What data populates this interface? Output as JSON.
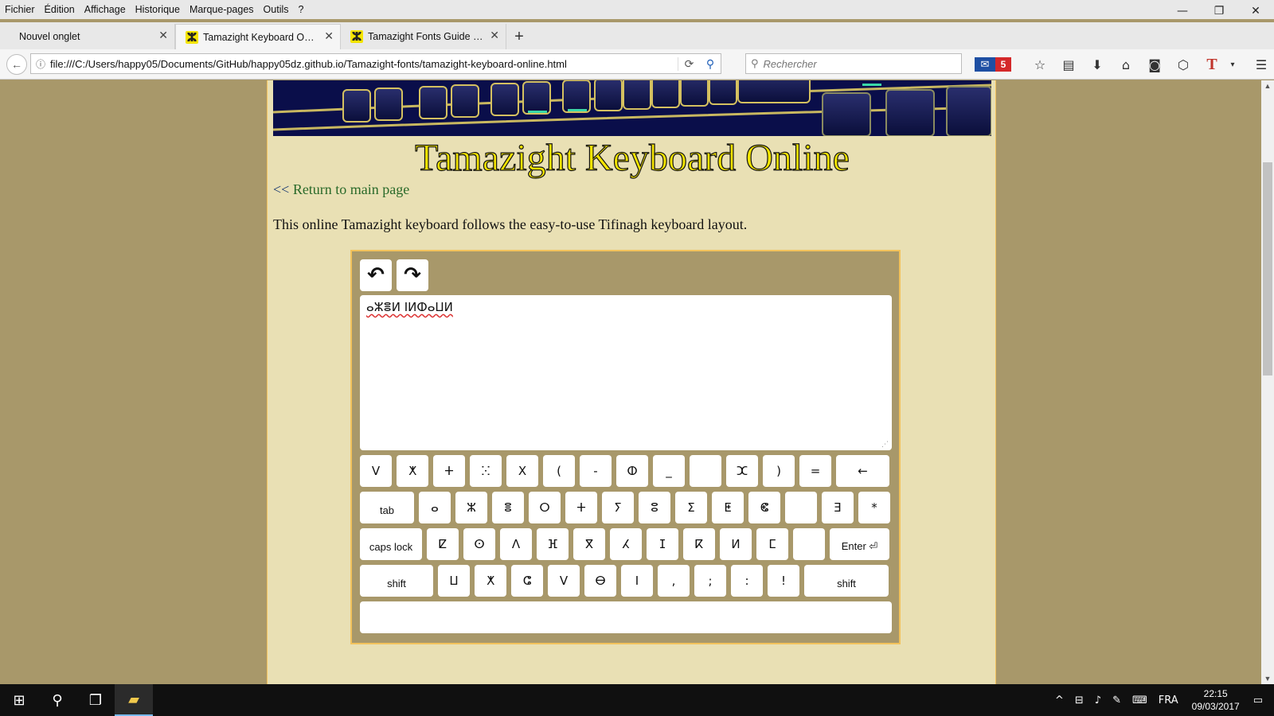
{
  "menu": [
    "Fichier",
    "Édition",
    "Affichage",
    "Historique",
    "Marque-pages",
    "Outils",
    "?"
  ],
  "window_controls": {
    "minimize": "—",
    "restore": "❐",
    "close": "✕"
  },
  "tabs": [
    {
      "title": "Nouvel onglet",
      "favicon": ""
    },
    {
      "title": "Tamazight Keyboard Onli...",
      "favicon": "ⵣ"
    },
    {
      "title": "Tamazight Fonts Guide - ...",
      "favicon": "ⵣ"
    }
  ],
  "tab_close": "✕",
  "new_tab": "+",
  "address": {
    "url": "file:///C:/Users/happy05/Documents/GitHub/happy05dz.github.io/Tamazight-fonts/tamazight-keyboard-online.html"
  },
  "search": {
    "placeholder": "Rechercher"
  },
  "toolbar": {
    "mail_count": "5"
  },
  "page": {
    "title": "Tamazight Keyboard Online",
    "return_prefix": "<< ",
    "return_link": "Return to main page",
    "intro": "This online Tamazight keyboard follows the easy-to-use Tifinagh keyboard layout."
  },
  "editor": {
    "undo": "↶",
    "redo": "↷",
    "text": "ⴰⵣⴻⵍ ⵏⵍⵀⴰⵡⵍ"
  },
  "keyboard": {
    "rows": [
      [
        "ⴸ",
        "ⵅ",
        "ⵜ",
        "ⵘ",
        "ⵝ",
        "(",
        "-",
        "ⵀ",
        "_",
        "",
        "ⵋ",
        ")",
        "=",
        "←"
      ],
      [
        "tab",
        "ⴰ",
        "ⵣ",
        "ⴻ",
        "ⵔ",
        "ⵜ",
        "ⵢ",
        "ⵓ",
        "ⵉ",
        "ⵟ",
        "ⵞ",
        "",
        "ⴺ",
        "*"
      ],
      [
        "caps lock",
        "ⵇ",
        "ⵙ",
        "ⴷ",
        "ⴼ",
        "ⴳ",
        "ⵃ",
        "ⵊ",
        "ⴽ",
        "ⵍ",
        "ⵎ",
        "",
        "Enter ⏎"
      ],
      [
        "shift",
        "ⵡ",
        "ⵅ",
        "ⵛ",
        "ⴸ",
        "ⴱ",
        "ⵏ",
        ",",
        ";",
        ":",
        "!",
        "shift"
      ]
    ]
  },
  "taskbar": {
    "language": "FRA",
    "time": "22:15",
    "date": "09/03/2017"
  }
}
